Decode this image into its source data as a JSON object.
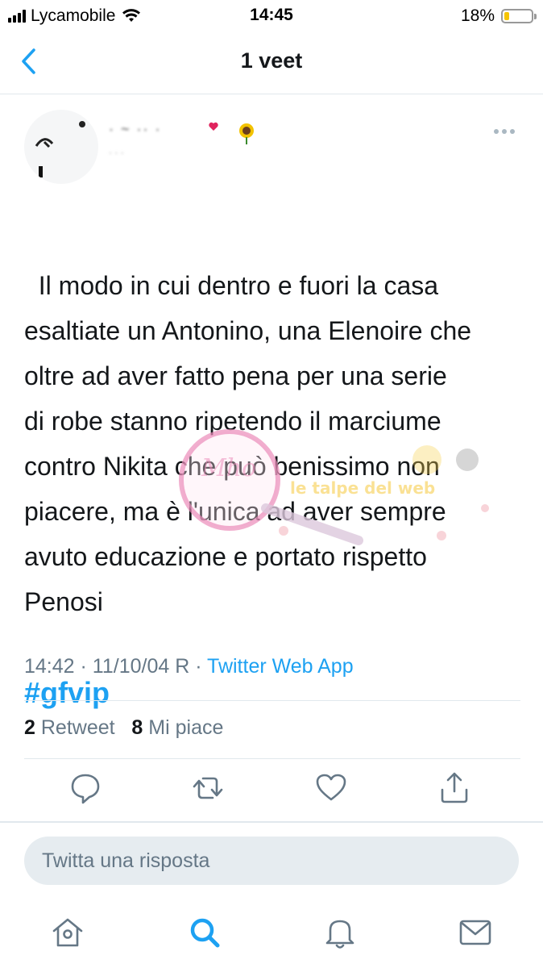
{
  "status_bar": {
    "carrier": "Lycamobile",
    "time": "14:45",
    "battery_percent": "18%",
    "battery_level": 0.18
  },
  "nav": {
    "title": "1 veet"
  },
  "tweet": {
    "text": "Il modo in cui dentro e fuori la casa\nesaltiate un Antonino, una Elenoire che\noltre ad aver fatto pena per una serie\ndi robe stanno ripetendo il marciume\ncontro Nikita che può benissimo non\npiacere, ma è l'unica ad aver sempre\navuto educazione e portato rispetto\nPenosi",
    "hashtag": "#gfvip",
    "time": "14:42",
    "date": "11/10/04 R",
    "separator": "·",
    "source": "Twitter Web App"
  },
  "stats": {
    "retweet_count": "2",
    "retweet_label": "Retweet",
    "like_count": "8",
    "like_label": "Mi piace"
  },
  "reply": {
    "placeholder": "Twitta una risposta"
  },
  "watermark": {
    "text": "le talpe del web"
  },
  "colors": {
    "accent": "#1da1f2",
    "muted": "#657786",
    "divider": "#e1e8ed",
    "battery": "#f5c400"
  },
  "icons": {
    "back": "chevron-left-icon",
    "more": "more-horizontal-icon",
    "reply": "reply-icon",
    "retweet": "retweet-icon",
    "like": "heart-icon",
    "share": "share-icon",
    "home": "home-icon",
    "search": "search-icon",
    "notifications": "bell-icon",
    "messages": "mail-icon"
  }
}
